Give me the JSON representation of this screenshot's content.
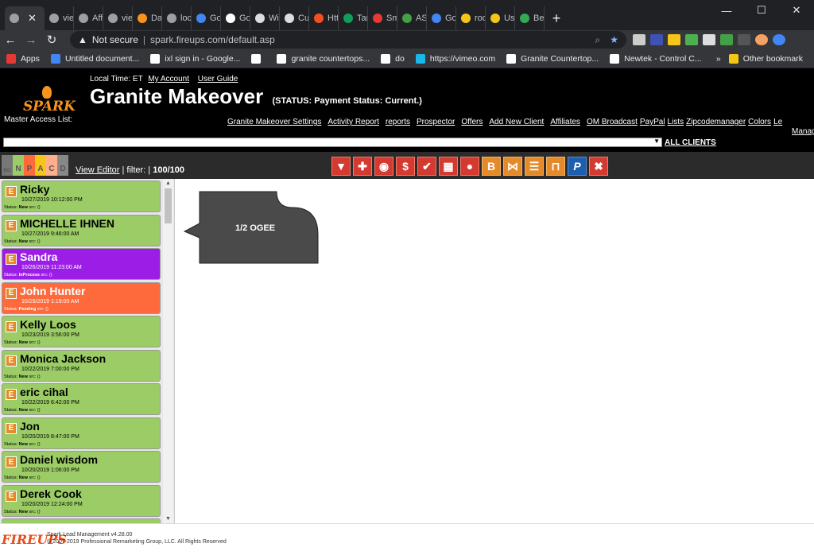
{
  "browser": {
    "tabs": [
      {
        "label": "",
        "icon": "globe-icon",
        "active": true
      },
      {
        "label": "viev",
        "icon": "globe-icon"
      },
      {
        "label": "Affc",
        "icon": "globe-icon"
      },
      {
        "label": "viev",
        "icon": "globe-icon"
      },
      {
        "label": "Das",
        "icon": "flame-icon"
      },
      {
        "label": "loca",
        "icon": "globe-icon"
      },
      {
        "label": "Goo",
        "icon": "calendar-icon"
      },
      {
        "label": "Goo",
        "icon": "google-icon"
      },
      {
        "label": "Wik",
        "icon": "wikipedia-icon"
      },
      {
        "label": "Cus",
        "icon": "wikipedia-icon"
      },
      {
        "label": "Http",
        "icon": "microsoft-icon"
      },
      {
        "label": "Tam",
        "icon": "sheet-icon"
      },
      {
        "label": "Sma",
        "icon": "arrow-icon"
      },
      {
        "label": "ASI",
        "icon": "card-icon"
      },
      {
        "label": "Goo",
        "icon": "calendar-icon"
      },
      {
        "label": "roo",
        "icon": "mail-icon"
      },
      {
        "label": "Use",
        "icon": "mail-icon"
      },
      {
        "label": "Bes",
        "icon": "maps-icon"
      }
    ],
    "not_secure": "Not secure",
    "url": "spark.fireups.com/default.asp",
    "bookmarks": [
      {
        "label": "Apps",
        "color": "#e53935"
      },
      {
        "label": "Untitled document...",
        "color": "#4285f4"
      },
      {
        "label": "ixl sign in - Google...",
        "color": "#ffffff"
      },
      {
        "label": "",
        "color": "#ffffff"
      },
      {
        "label": "granite countertops...",
        "color": "#ffffff"
      },
      {
        "label": "do",
        "color": "#ffffff"
      },
      {
        "label": "https://vimeo.com",
        "color": "#1ab7ea"
      },
      {
        "label": "Granite Countertop...",
        "color": "#ffffff"
      },
      {
        "label": "Newtek - Control C...",
        "color": "#ffffff"
      }
    ],
    "bookmarks_more": "»",
    "other_bookmarks": "Other bookmark"
  },
  "app": {
    "logo_text": "SPARK",
    "local_time_label": "Local Time: ET",
    "my_account": "My Account",
    "user_guide": "User Guide",
    "title": "Granite Makeover",
    "status": "(STATUS: Payment Status: Current.)",
    "master_access": "Master Access List:",
    "nav": [
      "Granite Makeover Settings",
      "Activity Report",
      "reports",
      "Prospector",
      "Offers",
      "Add New Client",
      "Affiliates",
      "OM Broadcast",
      "PayPal",
      "Lists",
      "Zipcodemanager",
      "Colors",
      "Le"
    ],
    "nav_overflow": "Manag",
    "all_clients": "ALL CLIENTS",
    "filters": [
      "BG",
      "N",
      "P",
      "A",
      "C",
      "D"
    ],
    "view_editor": "View Editor",
    "filter_label": "| filter: |",
    "filter_count": "100/100",
    "tool_icons": [
      "funnel-icon",
      "plus-icon",
      "target-icon",
      "dollar-icon",
      "check-icon",
      "grid-icon",
      "person-icon",
      "b-icon",
      "bowtie-icon",
      "notes-icon",
      "forklift-icon",
      "paypal-icon",
      "x-icon"
    ]
  },
  "leads": [
    {
      "name": "Ricky",
      "date": "10/27/2019 10:12:00 PM",
      "status": "New",
      "color": "#9ccc65"
    },
    {
      "name": "MICHELLE IHNEN",
      "date": "10/27/2019 9:46:00 AM",
      "status": "New",
      "color": "#9ccc65"
    },
    {
      "name": "Sandra",
      "date": "10/26/2019 11:23:00 AM",
      "status": "InProcess",
      "color": "#9c1ee6"
    },
    {
      "name": "John Hunter",
      "date": "10/25/2019 1:19:00 AM",
      "status": "Pending",
      "color": "#ff6a3d"
    },
    {
      "name": "Kelly Loos",
      "date": "10/23/2019 3:56:00 PM",
      "status": "New",
      "color": "#9ccc65"
    },
    {
      "name": "Monica Jackson",
      "date": "10/22/2019 7:00:00 PM",
      "status": "New",
      "color": "#9ccc65"
    },
    {
      "name": "eric cihal",
      "date": "10/22/2019 6:42:00 PM",
      "status": "New",
      "color": "#9ccc65"
    },
    {
      "name": "Jon",
      "date": "10/20/2019 8:47:00 PM",
      "status": "New",
      "color": "#9ccc65"
    },
    {
      "name": "Daniel wisdom",
      "date": "10/20/2019 1:06:00 PM",
      "status": "New",
      "color": "#9ccc65"
    },
    {
      "name": "Derek Cook",
      "date": "10/20/2019 12:24:00 PM",
      "status": "New",
      "color": "#9ccc65"
    },
    {
      "name": "",
      "date": "",
      "status": "",
      "color": "#9ccc65"
    }
  ],
  "lead_status_label": "Status:",
  "lead_src_label": "src: ()",
  "edge_profile_label": "1/2 OGEE",
  "footer": {
    "logo": "FIREUPS",
    "version": "Spark Lead Management v4.28.00",
    "copyright": "© 2007-2019 Professional Remarketing Group, LLC. All Rights Reserved"
  }
}
